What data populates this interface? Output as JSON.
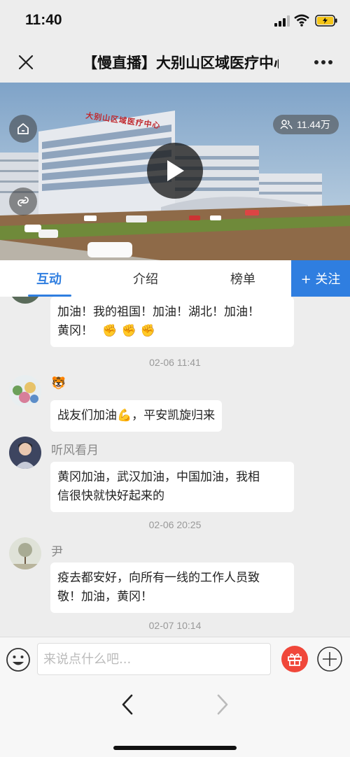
{
  "status_bar": {
    "time": "11:40"
  },
  "nav": {
    "title": "【慢直播】大别山区域医疗中心"
  },
  "video": {
    "viewers": "11.44万",
    "sign_text": "大别山区域医疗中心"
  },
  "tabs": {
    "items": [
      {
        "label": "互动"
      },
      {
        "label": "介绍"
      },
      {
        "label": "榜单"
      }
    ],
    "follow_label": "+ 关注"
  },
  "chat": {
    "msg0": {
      "text1": "加油！我的祖国！加油！湖北！加油！",
      "text2": "黄冈！",
      "emojis": "✊✊✊"
    },
    "ts1": "02-06 11:41",
    "msg1": {
      "name": "🐯",
      "text": "战友们加油💪，平安凯旋归来"
    },
    "msg2": {
      "name": "听风看月",
      "text1": "黄冈加油，武汉加油，中国加油，我相",
      "text2": "信很快就快好起来的"
    },
    "ts2": "02-06 20:25",
    "msg3": {
      "name": "尹",
      "text1": "疫去都安好，向所有一线的工作人员致",
      "text2": "敬！加油，黄冈！"
    },
    "ts3": "02-07 10:14"
  },
  "input": {
    "placeholder": "来说点什么吧..."
  },
  "colors": {
    "accent": "#2f7ee0",
    "gift": "#f0473a",
    "background": "#ededed"
  }
}
